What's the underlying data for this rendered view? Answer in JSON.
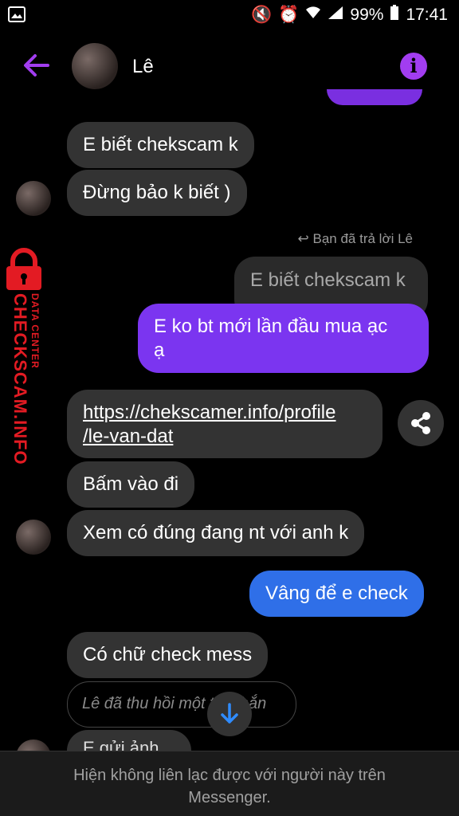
{
  "status": {
    "battery": "99%",
    "time": "17:41"
  },
  "header": {
    "name": "Lê"
  },
  "messages": {
    "m1": "E biết chekscam k",
    "m2": "Đừng bảo k biết )",
    "reply_note": "Bạn đã trả lời Lê",
    "quoted": "E biết chekscam k",
    "m3": "E ko bt mới lần đầu mua ạc",
    "m3b": "ạ",
    "link1": "https://chekscamer.info/profile",
    "link2": "/le-van-dat",
    "m4": "Bấm vào đi",
    "m5": "Xem có đúng đang nt với anh k",
    "m6": "Vâng để e check",
    "m7": "Có chữ check mess",
    "recalled": "Lê đã thu hồi một tin nhắn",
    "peek": "E gửi ảnh"
  },
  "watermark": {
    "brand": "CHECKSCAM.INFO",
    "sub": "DATA CENTER"
  },
  "footer": {
    "line1": "Hiện không liên lạc được với người này trên",
    "line2": "Messenger."
  },
  "colors": {
    "accent": "#a23df0",
    "bubble_mine": "#7b35f0",
    "bubble_blue": "#2f6fe8",
    "watermark": "#e31b23"
  }
}
